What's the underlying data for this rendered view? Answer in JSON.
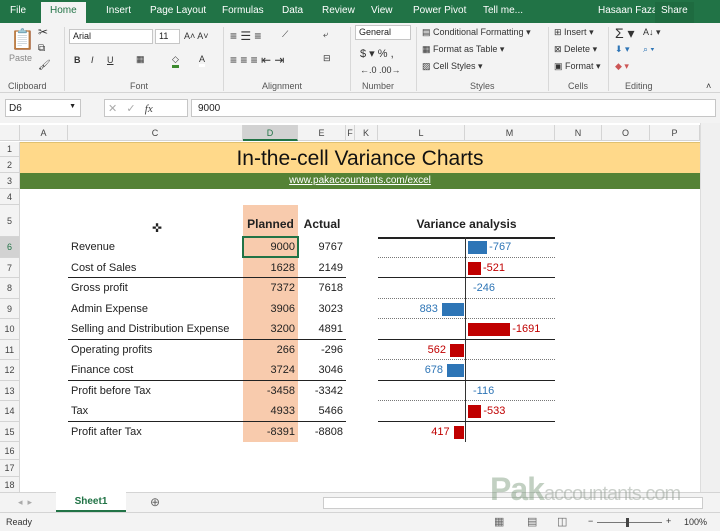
{
  "ribbon_tabs": [
    "File",
    "Home",
    "Insert",
    "Page Layout",
    "Formulas",
    "Data",
    "Review",
    "View",
    "Power Pivot",
    "Tell me..."
  ],
  "user": "Hasaan Fazal",
  "share": "Share",
  "ribbon": {
    "paste": "Paste",
    "font_name": "Arial",
    "font_size": "11",
    "number_format": "General",
    "conditional_formatting": "Conditional Formatting",
    "format_as_table": "Format as Table",
    "cell_styles": "Cell Styles",
    "insert": "Insert",
    "delete": "Delete",
    "format": "Format",
    "groups": [
      "Clipboard",
      "Font",
      "Alignment",
      "Number",
      "Styles",
      "Cells",
      "Editing"
    ]
  },
  "formula_bar": {
    "name_box": "D6",
    "fx": "fx",
    "value": "9000"
  },
  "columns": [
    "A",
    "C",
    "D",
    "E",
    "F",
    "K",
    "L",
    "M",
    "N",
    "O",
    "P"
  ],
  "rows": [
    "1",
    "2",
    "3",
    "4",
    "5",
    "6",
    "7",
    "8",
    "9",
    "10",
    "11",
    "12",
    "13",
    "14",
    "15",
    "16",
    "17",
    "18"
  ],
  "sheet": {
    "title": "In-the-cell Variance Charts",
    "url": "www.pakaccountants.com/excel",
    "h_planned": "Planned",
    "h_actual": "Actual",
    "h_variance": "Variance analysis",
    "lines": [
      {
        "label": "Revenue",
        "planned": "9000",
        "actual": "9767",
        "variance": -767,
        "vlabel": "-767",
        "color": "#2e75b6"
      },
      {
        "label": "Cost of Sales",
        "planned": "1628",
        "actual": "2149",
        "variance": -521,
        "vlabel": "-521",
        "color": "#c00000"
      },
      {
        "label": "Gross profit",
        "planned": "7372",
        "actual": "7618",
        "variance": -246,
        "vlabel": "-246",
        "color": "#2e75b6"
      },
      {
        "label": "Admin Expense",
        "planned": "3906",
        "actual": "3023",
        "variance": 883,
        "vlabel": "883",
        "color": "#2e75b6"
      },
      {
        "label": "Selling and Distribution Expense",
        "planned": "3200",
        "actual": "4891",
        "variance": -1691,
        "vlabel": "-1691",
        "color": "#c00000"
      },
      {
        "label": "Operating profits",
        "planned": "266",
        "actual": "-296",
        "variance": 562,
        "vlabel": "562",
        "color": "#c00000"
      },
      {
        "label": "Finance cost",
        "planned": "3724",
        "actual": "3046",
        "variance": 678,
        "vlabel": "678",
        "color": "#2e75b6"
      },
      {
        "label": "Profit before Tax",
        "planned": "-3458",
        "actual": "-3342",
        "variance": -116,
        "vlabel": "-116",
        "color": "#2e75b6"
      },
      {
        "label": "Tax",
        "planned": "4933",
        "actual": "5466",
        "variance": -533,
        "vlabel": "-533",
        "color": "#c00000"
      },
      {
        "label": "Profit after Tax",
        "planned": "-8391",
        "actual": "-8808",
        "variance": 417,
        "vlabel": "417",
        "color": "#c00000"
      }
    ]
  },
  "sheet_tab": "Sheet1",
  "watermark": "Pakaccountants.com",
  "status": {
    "ready": "Ready",
    "zoom": "100%"
  }
}
